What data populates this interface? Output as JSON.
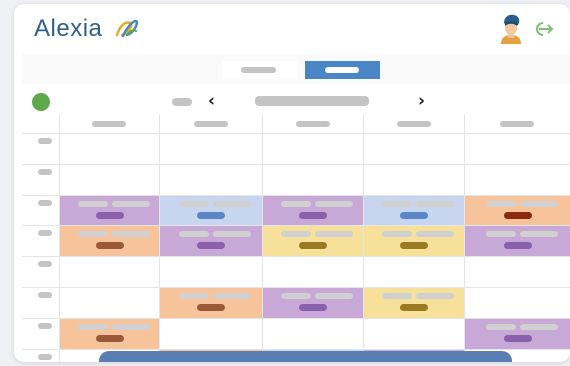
{
  "app": {
    "brand_name": "Alexia"
  },
  "colors": {
    "purple": "#c8a8d6",
    "purple_pill": "#8a5fac",
    "blue": "#c7d6ee",
    "blue_pill": "#5a86c6",
    "orange": "#f6c39a",
    "orange_pill": "#9a5a3a",
    "yellow": "#f6e09a",
    "yellow_pill": "#9a7a20",
    "red_pill": "#8a2a10",
    "status_green": "#5eaa4a",
    "toggle_active": "#4a86c6",
    "panel": "#5a7eb3"
  },
  "icons": {
    "logo": "alexia-logo-icon",
    "avatar": "user-avatar-icon",
    "logout": "logout-icon",
    "prev": "chevron-left-icon",
    "next": "chevron-right-icon"
  },
  "nav": {
    "prev_glyph": "‹",
    "next_glyph": "›"
  },
  "events": [
    {
      "row": 2,
      "col": 0,
      "color": "purple"
    },
    {
      "row": 2,
      "col": 1,
      "color": "blue"
    },
    {
      "row": 2,
      "col": 2,
      "color": "purple"
    },
    {
      "row": 2,
      "col": 3,
      "color": "blue"
    },
    {
      "row": 2,
      "col": 4,
      "color": "orange",
      "pill": "red_pill"
    },
    {
      "row": 3,
      "col": 0,
      "color": "orange"
    },
    {
      "row": 3,
      "col": 1,
      "color": "purple"
    },
    {
      "row": 3,
      "col": 2,
      "color": "yellow"
    },
    {
      "row": 3,
      "col": 3,
      "color": "yellow"
    },
    {
      "row": 3,
      "col": 4,
      "color": "purple"
    },
    {
      "row": 5,
      "col": 1,
      "color": "orange"
    },
    {
      "row": 5,
      "col": 2,
      "color": "purple"
    },
    {
      "row": 5,
      "col": 3,
      "color": "yellow"
    },
    {
      "row": 6,
      "col": 0,
      "color": "orange"
    },
    {
      "row": 6,
      "col": 4,
      "color": "purple"
    },
    {
      "row": 7,
      "col": 1,
      "color": "orange"
    },
    {
      "row": 7,
      "col": 2,
      "color": "blue"
    },
    {
      "row": 7,
      "col": 3,
      "color": "purple"
    }
  ]
}
